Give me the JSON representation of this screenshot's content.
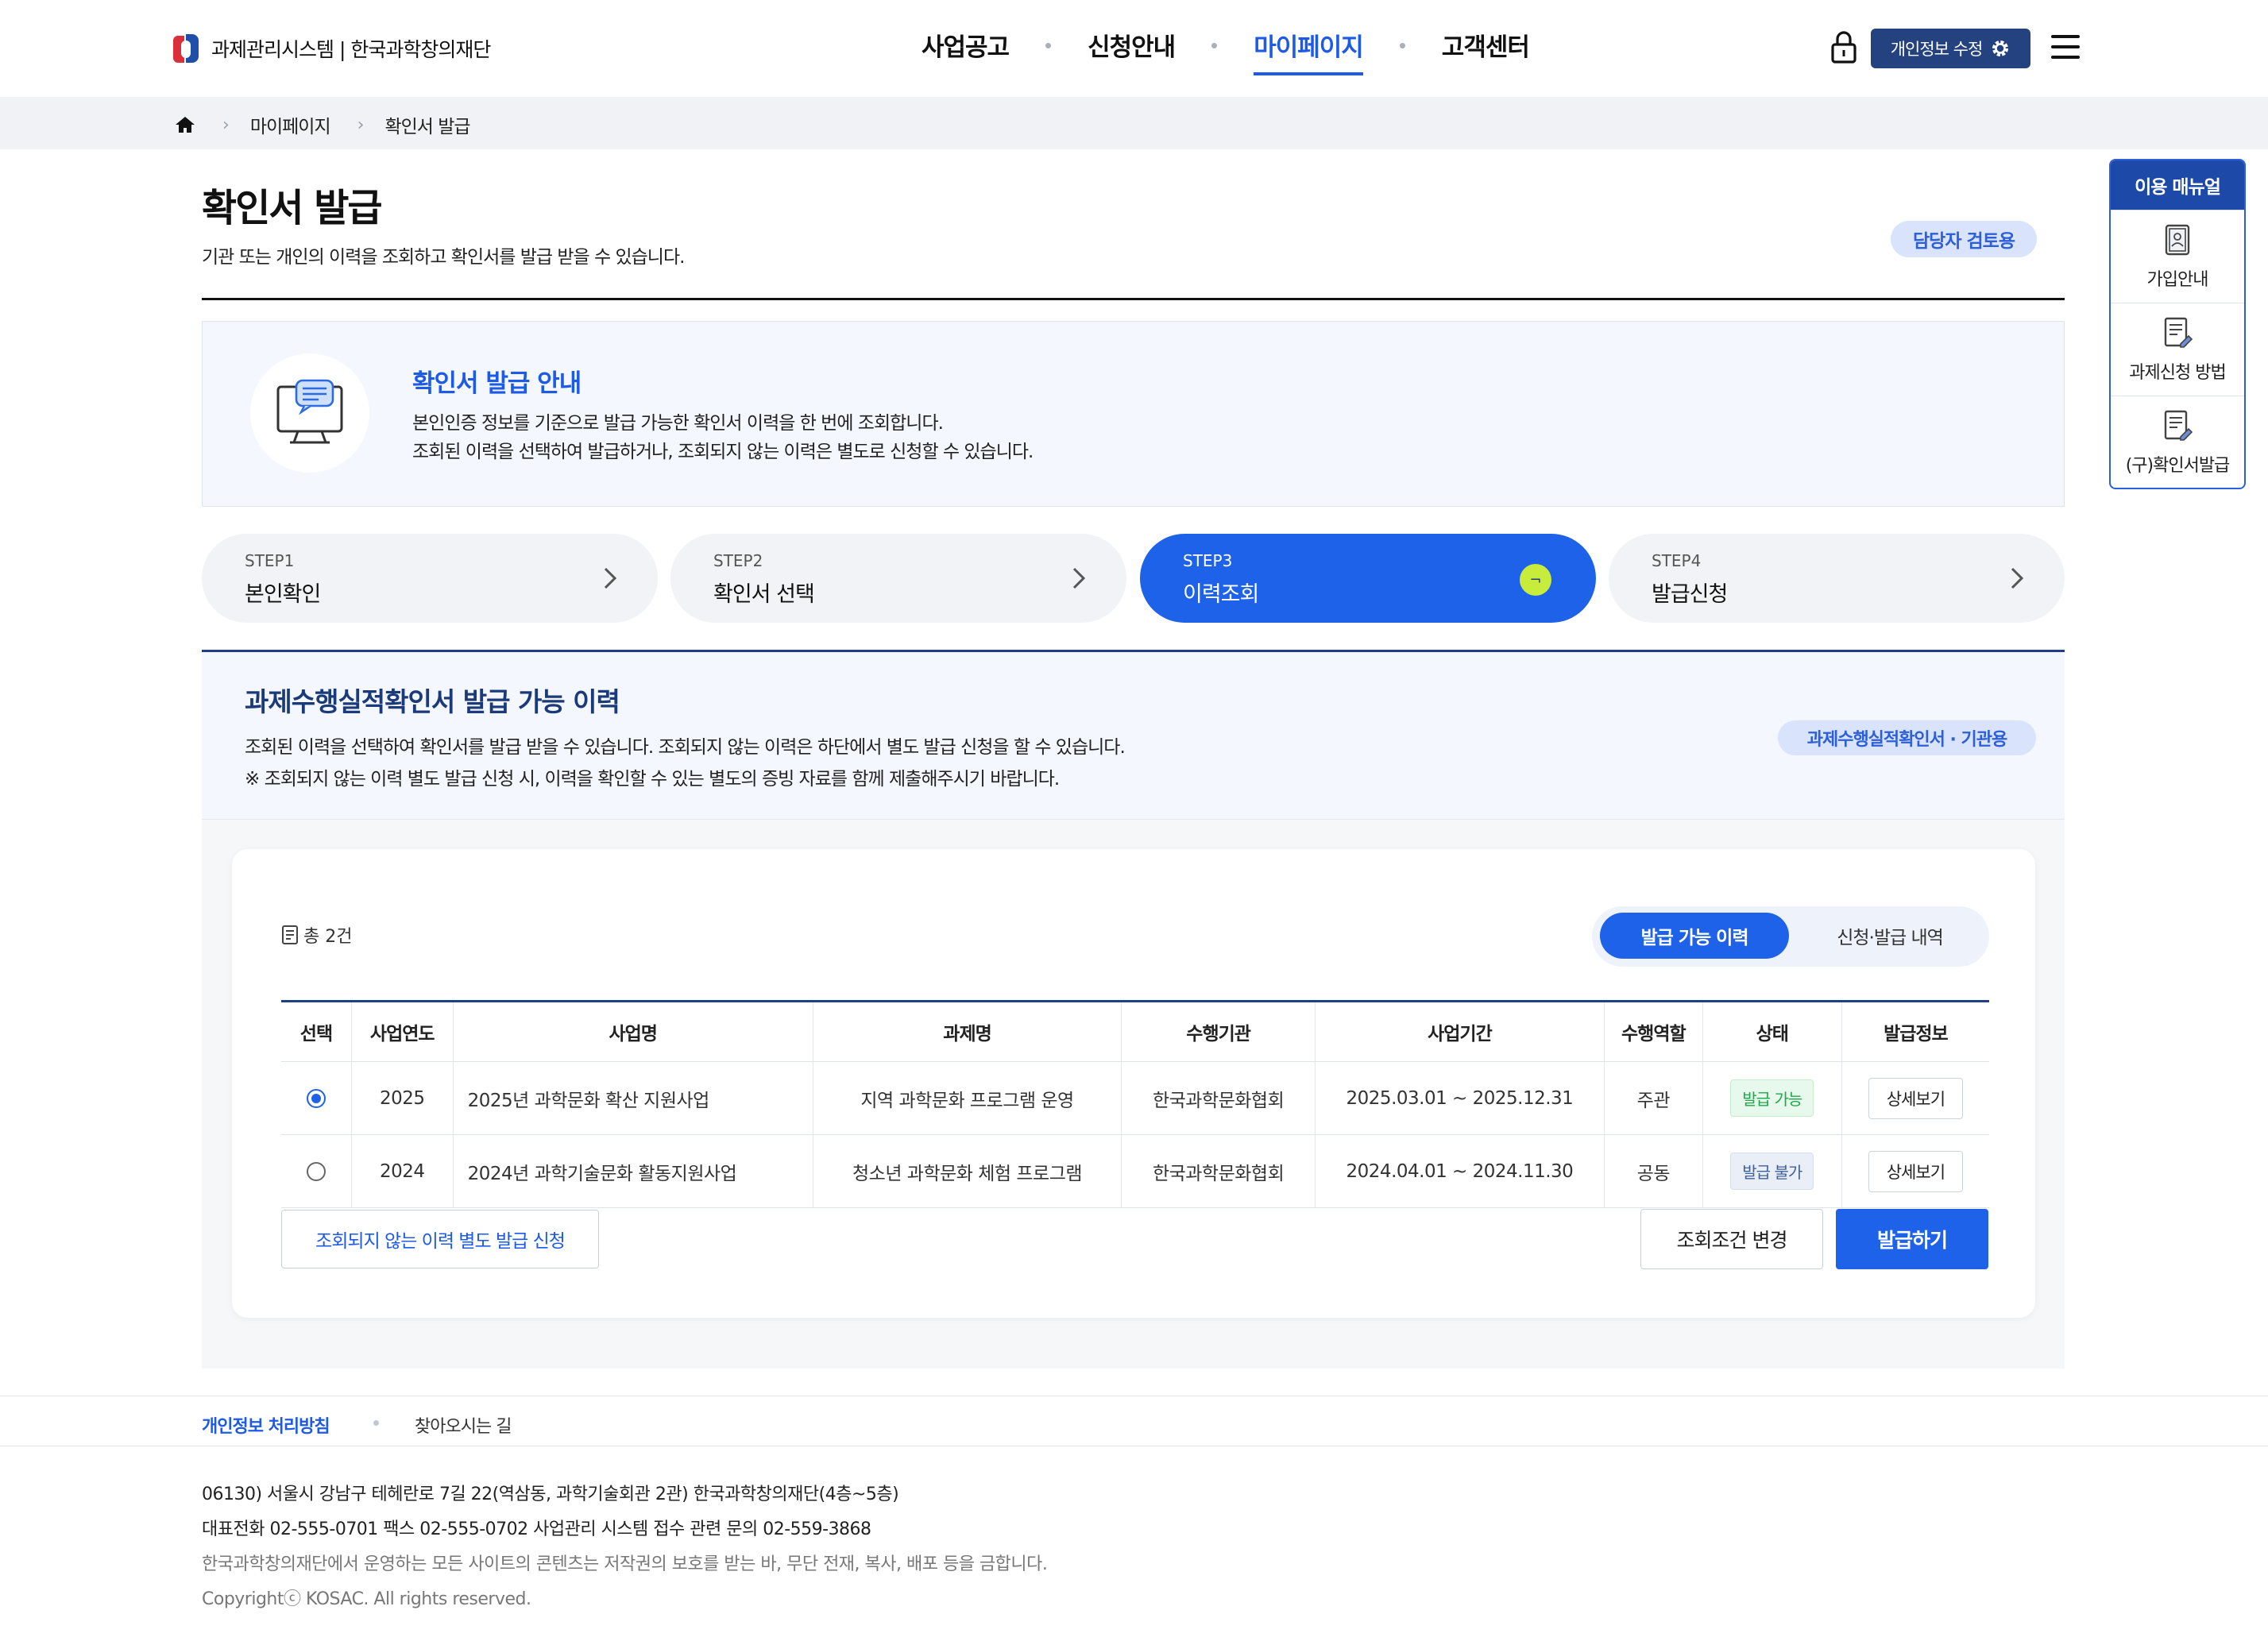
{
  "header": {
    "logo_text": "과제관리시스템 | 한국과학창의재단",
    "nav": [
      "사업공고",
      "신청안내",
      "마이페이지",
      "고객센터"
    ],
    "profile_button": "개인정보 수정"
  },
  "breadcrumb": [
    "마이페이지",
    "확인서 발급"
  ],
  "page": {
    "title": "확인서 발급",
    "description": "기관 또는 개인의 이력을 조회하고 확인서를 발급 받을 수 있습니다.",
    "role_badge": "담당자 검토용"
  },
  "quick_menu": {
    "title": "이용 매뉴얼",
    "items": [
      "가입안내",
      "과제신청 방법",
      "(구)확인서발급"
    ]
  },
  "guide": {
    "title": "확인서 발급 안내",
    "line1": "본인인증 정보를 기준으로 발급 가능한 확인서 이력을 한 번에 조회합니다.",
    "line2": "조회된 이력을 선택하여 발급하거나, 조회되지 않는 이력은 별도로 신청할 수 있습니다."
  },
  "steps": [
    {
      "num": "STEP1",
      "name": "본인확인"
    },
    {
      "num": "STEP2",
      "name": "확인서 선택"
    },
    {
      "num": "STEP3",
      "name": "이력조회"
    },
    {
      "num": "STEP4",
      "name": "발급신청"
    }
  ],
  "active_step": 3,
  "result": {
    "title": "과제수행실적확인서 발급 가능 이력",
    "desc1": "조회된 이력을 선택하여 확인서를 발급 받을 수 있습니다. 조회되지 않는 이력은 하단에서 별도 발급 신청을 할 수 있습니다.",
    "desc2": "※ 조회되지 않는 이력 별도 발급 신청 시, 이력을 확인할 수 있는 별도의 증빙 자료를 함께 제출해주시기 바랍니다.",
    "type_badge": "과제수행실적확인서 · 기관용",
    "count": "총 2건",
    "tabs": [
      "발급 가능 이력",
      "신청·발급 내역"
    ],
    "columns": [
      "선택",
      "사업연도",
      "사업명",
      "과제명",
      "수행기관",
      "사업기간",
      "수행역할",
      "상태",
      "발급정보"
    ],
    "rows": [
      {
        "selected": true,
        "year": "2025",
        "business": "2025년 과학문화 확산 지원사업",
        "project": "지역 과학문화 프로그램 운영",
        "org": "한국과학문화협회",
        "period": "2025.03.01 ~ 2025.12.31",
        "role": "주관",
        "status": "발급 가능",
        "detail": "상세보기"
      },
      {
        "selected": false,
        "year": "2024",
        "business": "2024년 과학기술문화 활동지원사업",
        "project": "청소년 과학문화 체험 프로그램",
        "org": "한국과학문화협회",
        "period": "2024.04.01 ~ 2024.11.30",
        "role": "공동",
        "status": "발급 불가",
        "detail": "상세보기"
      }
    ],
    "btn_separate": "조회되지 않는 이력 별도 발급 신청",
    "btn_change": "조회조건 변경",
    "btn_issue": "발급하기"
  },
  "footer": {
    "link_privacy": "개인정보 처리방침",
    "link_directions": "찾아오시는 길",
    "address": "06130) 서울시 강남구 테헤란로 7길 22(역삼동, 과학기술회관 2관) 한국과학창의재단(4층~5층)",
    "phone": "대표전화 02-555-0701 팩스 02-555-0702 사업관리 시스템 접수 관련 문의 02-559-3868",
    "copyright_notice": "한국과학창의재단에서 운영하는 모든 사이트의 콘텐츠는 저작권의 보호를 받는 바, 무단 전재, 복사, 배포 등을 금합니다.",
    "copyright": "Copyrightⓒ KOSAC. All rights reserved."
  }
}
